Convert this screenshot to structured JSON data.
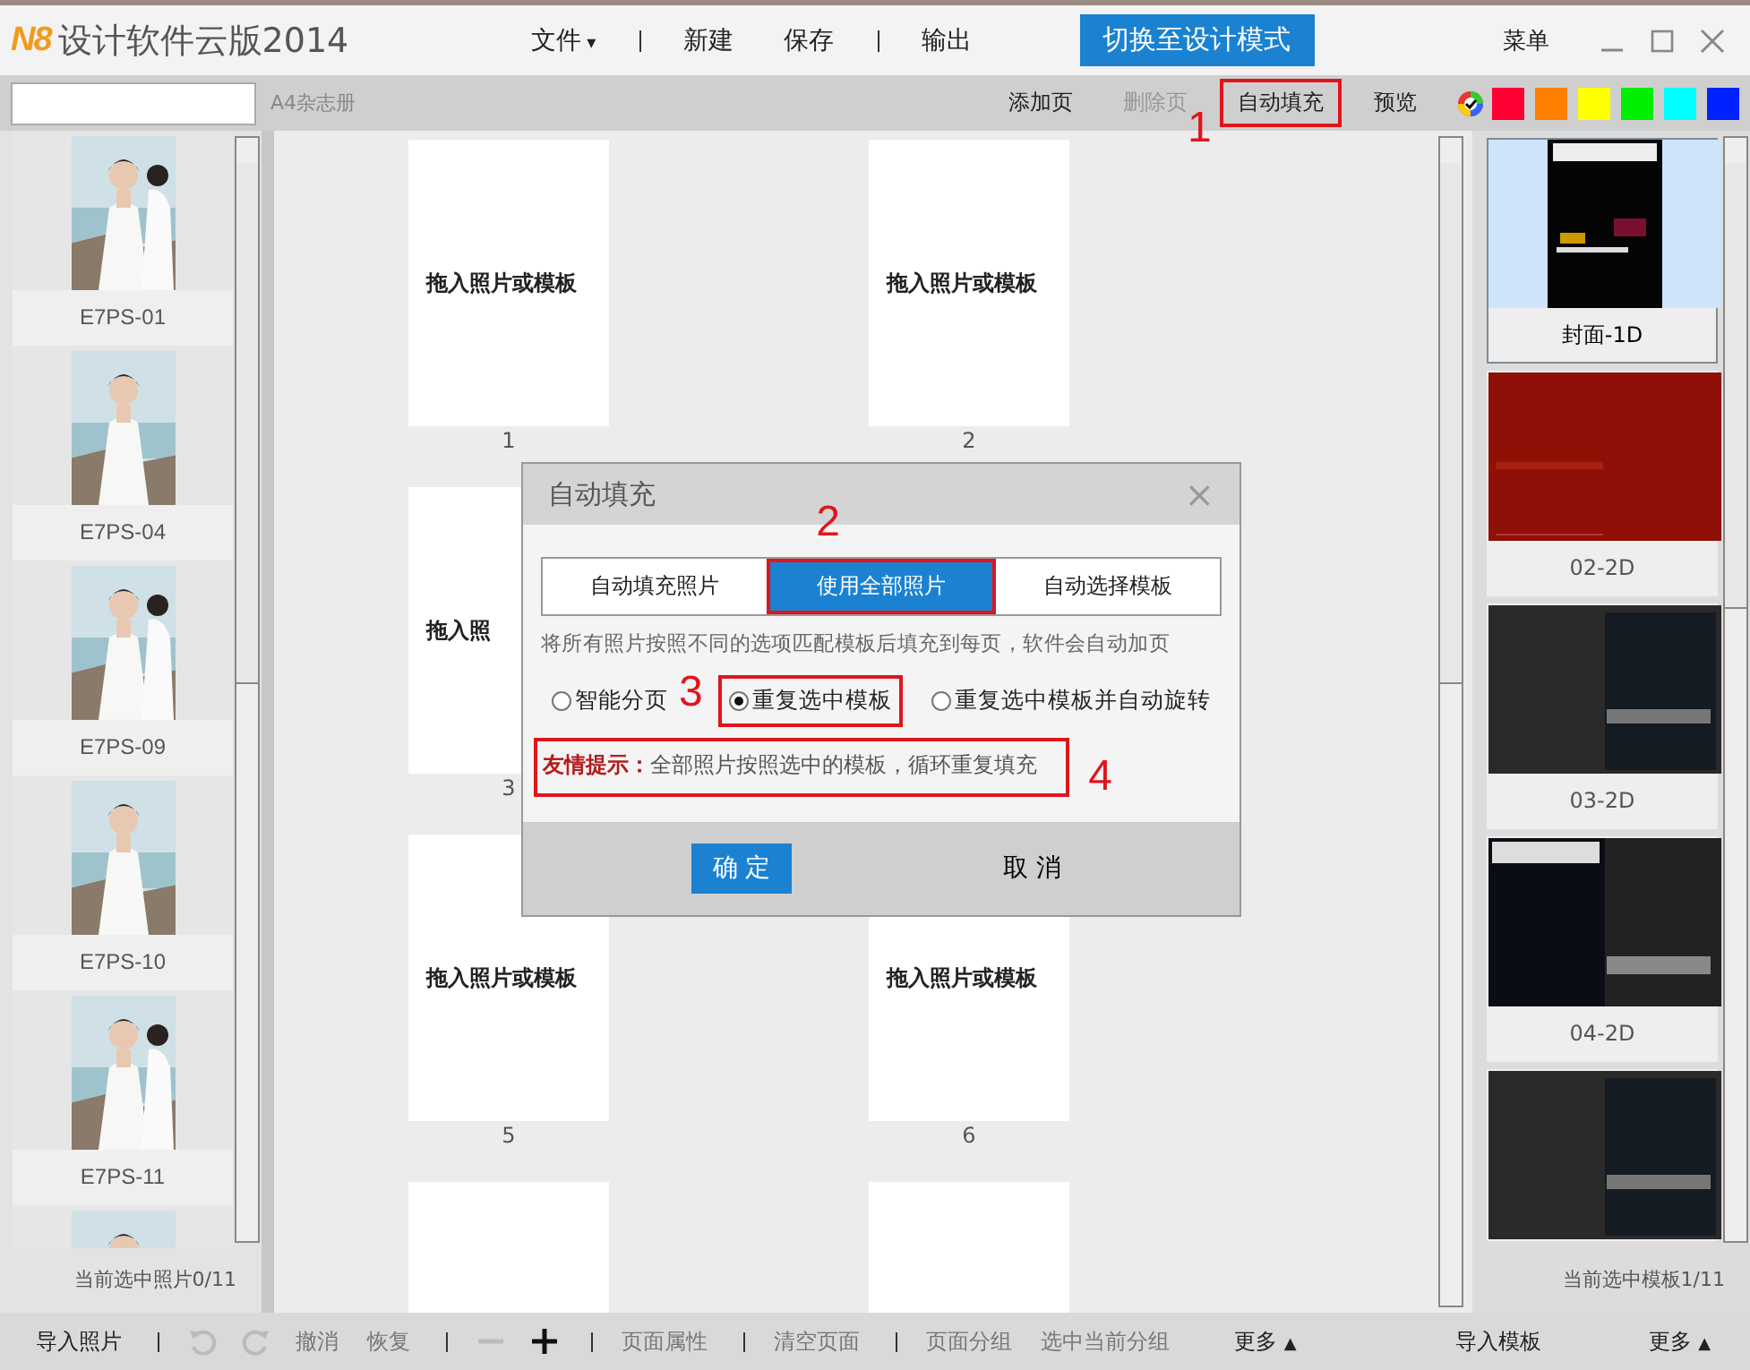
{
  "app": {
    "logo": "N8",
    "title": "设计软件云版2014"
  },
  "menu": [
    {
      "label": "文件",
      "caret": "▾"
    },
    {
      "label": "新建"
    },
    {
      "label": "保存"
    },
    {
      "label": "输出"
    }
  ],
  "mode_button": "切换至设计模式",
  "menu_button": "菜单",
  "toolbar": {
    "doc_type": "A4杂志册",
    "actions": [
      {
        "label": "添加页",
        "disabled": false,
        "highlighted": false
      },
      {
        "label": "删除页",
        "disabled": true,
        "highlighted": false
      },
      {
        "label": "自动填充",
        "disabled": false,
        "highlighted": true,
        "callout": "1"
      },
      {
        "label": "预览",
        "disabled": false,
        "highlighted": false
      }
    ],
    "swatches": [
      {
        "color": "#ff0033"
      },
      {
        "color": "#ff8000"
      },
      {
        "color": "#ffff00"
      },
      {
        "color": "#00ee00"
      },
      {
        "color": "#00ffff"
      },
      {
        "color": "#0022ff"
      }
    ]
  },
  "photos": [
    {
      "label": "E7PS-01"
    },
    {
      "label": "E7PS-04"
    },
    {
      "label": "E7PS-09"
    },
    {
      "label": "E7PS-10"
    },
    {
      "label": "E7PS-11"
    },
    {
      "kind": "picture"
    }
  ],
  "photo_status": "当前选中照片0/11",
  "pages": [
    {
      "kind": "slot",
      "text": "拖入照片或模板",
      "number": "1"
    },
    {
      "kind": "slot",
      "text": "拖入照片或模板",
      "number": "2"
    },
    {
      "kind": "slot",
      "text": "拖入照",
      "number": "3"
    },
    {
      "kind": "hidden"
    },
    {
      "kind": "slot",
      "text": "拖入照片或模板",
      "number": "5"
    },
    {
      "kind": "slot",
      "text": "拖入照片或模板",
      "number": "6"
    },
    {
      "kind": "slot"
    },
    {
      "kind": "slot"
    }
  ],
  "templates": [
    {
      "label": "封面-1D",
      "selected": true,
      "kind": "cover"
    },
    {
      "label": "02-2D",
      "selected": false,
      "kind": "red"
    },
    {
      "label": "03-2D",
      "selected": false,
      "kind": "dark"
    },
    {
      "label": "04-2D",
      "selected": false,
      "kind": "vogue"
    },
    {
      "selected": false,
      "kind": "dark"
    }
  ],
  "template_status": "当前选中模板1/11",
  "dialog": {
    "title": "自动填充",
    "close": "×",
    "tabs": [
      {
        "label": "自动填充照片",
        "selected": false,
        "highlighted": false
      },
      {
        "label": "使用全部照片",
        "selected": true,
        "highlighted": true,
        "callout": "2"
      },
      {
        "label": "自动选择模板",
        "selected": false,
        "highlighted": false
      }
    ],
    "description": "将所有照片按照不同的选项匹配模板后填充到每页，软件会自动加页",
    "options": [
      {
        "label": "智能分页",
        "selected": false,
        "highlighted": false
      },
      {
        "label": "重复选中模板",
        "selected": true,
        "highlighted": true,
        "callout": "3"
      },
      {
        "label": "重复选中模板并自动旋转",
        "selected": false,
        "highlighted": false
      }
    ],
    "tip": {
      "text": "**友情提示：**全部照片按照选中的模板，循环重复填充",
      "highlighted": true,
      "callout": "4"
    },
    "ok": "确 定",
    "cancel": "取 消"
  },
  "bottom_bar": [
    {
      "kind": "text",
      "label": "导入照片",
      "dim": false
    },
    {
      "kind": "separator"
    },
    {
      "kind": "undo"
    },
    {
      "kind": "redo"
    },
    {
      "kind": "text",
      "label": "撤消",
      "dim": true
    },
    {
      "kind": "text",
      "label": "恢复",
      "dim": true
    },
    {
      "kind": "separator"
    },
    {
      "kind": "minus"
    },
    {
      "kind": "plus"
    },
    {
      "kind": "separator"
    },
    {
      "kind": "text",
      "label": "页面属性",
      "dim": true
    },
    {
      "kind": "separator"
    },
    {
      "kind": "text",
      "label": "清空页面",
      "dim": true
    },
    {
      "kind": "separator"
    },
    {
      "kind": "text",
      "label": "页面分组",
      "dim": true
    },
    {
      "kind": "text",
      "label": "选中当前分组",
      "dim": true
    },
    {
      "kind": "more",
      "label": "更多",
      "caret": "▲"
    }
  ],
  "bottom_right": [
    {
      "kind": "text",
      "label": "导入模板"
    },
    {
      "kind": "more",
      "label": "更多",
      "caret": "▲"
    }
  ]
}
